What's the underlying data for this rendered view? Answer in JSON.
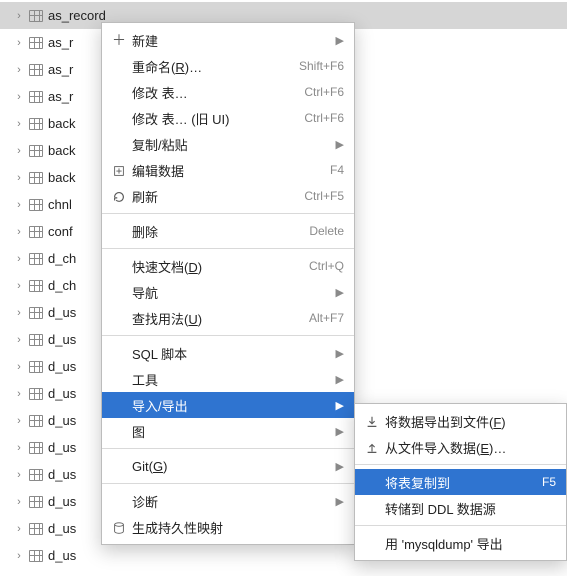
{
  "tree": {
    "items": [
      {
        "label": "as_record",
        "selected": true
      },
      {
        "label": "as_r"
      },
      {
        "label": "as_r"
      },
      {
        "label": "as_r"
      },
      {
        "label": "back"
      },
      {
        "label": "back"
      },
      {
        "label": "back"
      },
      {
        "label": "chnl"
      },
      {
        "label": "conf"
      },
      {
        "label": "d_ch"
      },
      {
        "label": "d_ch"
      },
      {
        "label": "d_us"
      },
      {
        "label": "d_us"
      },
      {
        "label": "d_us"
      },
      {
        "label": "d_us"
      },
      {
        "label": "d_us"
      },
      {
        "label": "d_us"
      },
      {
        "label": "d_us"
      },
      {
        "label": "d_us"
      },
      {
        "label": "d_us"
      },
      {
        "label": "d_us"
      }
    ]
  },
  "menu": {
    "new": {
      "label": "新建"
    },
    "rename": {
      "label_pre": "重命名(",
      "mn": "R",
      "label_post": ")…",
      "shortcut": "Shift+F6"
    },
    "modify": {
      "label": "修改 表…",
      "shortcut": "Ctrl+F6"
    },
    "modify_old": {
      "label": "修改 表… (旧 UI)",
      "shortcut": "Ctrl+F6"
    },
    "copypaste": {
      "label": "复制/粘贴"
    },
    "edit_data": {
      "label": "编辑数据",
      "shortcut": "F4"
    },
    "refresh": {
      "label": "刷新",
      "shortcut": "Ctrl+F5"
    },
    "delete": {
      "label": "删除",
      "shortcut": "Delete"
    },
    "quickdoc": {
      "label_pre": "快速文档(",
      "mn": "D",
      "label_post": ")",
      "shortcut": "Ctrl+Q"
    },
    "nav": {
      "label": "导航"
    },
    "usages": {
      "label_pre": "查找用法(",
      "mn": "U",
      "label_post": ")",
      "shortcut": "Alt+F7"
    },
    "sql": {
      "label": "SQL 脚本"
    },
    "tools": {
      "label": "工具"
    },
    "impexp": {
      "label": "导入/导出"
    },
    "diagram": {
      "label": "图"
    },
    "git": {
      "label_pre": "Git(",
      "mn": "G",
      "label_post": ")"
    },
    "diag": {
      "label": "诊断"
    },
    "genpersist": {
      "label": "生成持久性映射"
    }
  },
  "submenu": {
    "export_file": {
      "label_pre": "将数据导出到文件(",
      "mn": "F",
      "label_post": ")"
    },
    "import_file": {
      "label_pre": "从文件导入数据(",
      "mn": "E",
      "label_post": ")…"
    },
    "copy_table": {
      "label": "将表复制到",
      "shortcut": "F5"
    },
    "dump_ddl": {
      "label": "转储到 DDL 数据源"
    },
    "mysqldump": {
      "label": "用 'mysqldump' 导出"
    }
  }
}
